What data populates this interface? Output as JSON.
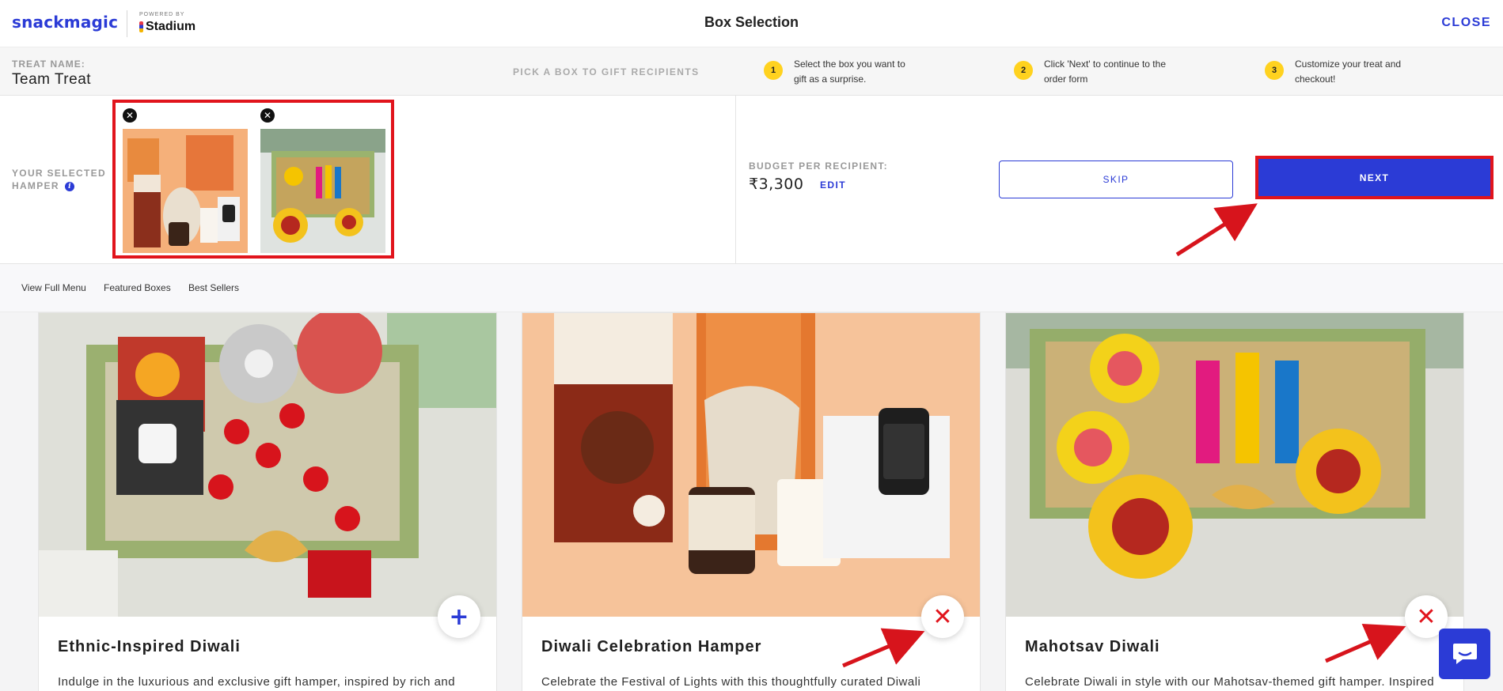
{
  "header": {
    "logo": "snackmagic",
    "powered_by": "POWERED BY",
    "partner": "Stadium",
    "title": "Box Selection",
    "close_label": "CLOSE"
  },
  "infobar": {
    "treat_label": "TREAT NAME:",
    "treat_name": "Team Treat",
    "pick_label": "PICK A BOX TO GIFT RECIPIENTS",
    "steps": [
      {
        "num": "1",
        "text": "Select the box you want to gift as a surprise."
      },
      {
        "num": "2",
        "text": "Click 'Next' to continue to the order form"
      },
      {
        "num": "3",
        "text": "Customize your treat and checkout!"
      }
    ]
  },
  "selection": {
    "label_line1": "YOUR SELECTED",
    "label_line2": "HAMPER",
    "info_icon": "i",
    "remove_icon": "✕",
    "budget_label": "BUDGET PER RECIPIENT:",
    "budget_value": "₹3,300",
    "edit_label": "EDIT",
    "skip_label": "SKIP",
    "next_label": "NEXT"
  },
  "nav": {
    "items": [
      "View Full Menu",
      "Featured Boxes",
      "Best Sellers"
    ]
  },
  "products": [
    {
      "title": "Ethnic-Inspired Diwali",
      "desc": "Indulge in the luxurious and exclusive gift hamper, inspired by rich and",
      "action_icon": "+"
    },
    {
      "title": "Diwali Celebration Hamper",
      "desc": "Celebrate the Festival of Lights with this thoughtfully curated Diwali",
      "action_icon": "✕"
    },
    {
      "title": "Mahotsav Diwali",
      "desc": "Celebrate Diwali in style with our Mahotsav-themed gift hamper. Inspired",
      "action_icon": "✕"
    }
  ],
  "colors": {
    "brand_blue": "#2b3bd6",
    "highlight_red": "#e1141c",
    "step_yellow": "#ffd21f"
  }
}
